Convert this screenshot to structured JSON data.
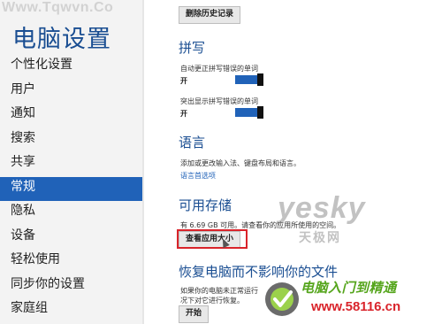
{
  "watermark_top": "Www.Tqwvn.Co",
  "nav": {
    "title": "电脑设置",
    "items": [
      {
        "label": "个性化设置"
      },
      {
        "label": "用户"
      },
      {
        "label": "通知"
      },
      {
        "label": "搜索"
      },
      {
        "label": "共享"
      },
      {
        "label": "常规"
      },
      {
        "label": "隐私"
      },
      {
        "label": "设备"
      },
      {
        "label": "轻松使用"
      },
      {
        "label": "同步你的设置"
      },
      {
        "label": "家庭组"
      }
    ],
    "selected_label": "常规"
  },
  "content": {
    "clear_history_button": "删除历史记录",
    "spelling": {
      "heading": "拼写",
      "autocorrect_label": "自动更正拼写错误的单词",
      "autocorrect_state": "开",
      "highlight_label": "突出显示拼写错误的单词",
      "highlight_state": "开"
    },
    "language": {
      "heading": "语言",
      "description": "添加或更改输入法、键盘布局和语言。",
      "link": "语言首选项"
    },
    "storage": {
      "heading": "可用存储",
      "description": "有 6.69 GB 可用。请查看你的应用所使用的空间。",
      "button": "查看应用大小"
    },
    "recover": {
      "heading": "恢复电脑而不影响你的文件",
      "description_line1": "如果你的电脑未正常运行",
      "description_line2": "况下对它进行恢复。",
      "button": "开始"
    }
  },
  "watermarks": {
    "yesky": "yesky",
    "tianji": "天极网",
    "brand": "电脑入门到精通",
    "url": "www.58116.cn"
  },
  "colors": {
    "accent": "#2062b8",
    "title": "#1a4e92",
    "highlight_box": "#d9242b",
    "brand_green": "#55a51c"
  }
}
